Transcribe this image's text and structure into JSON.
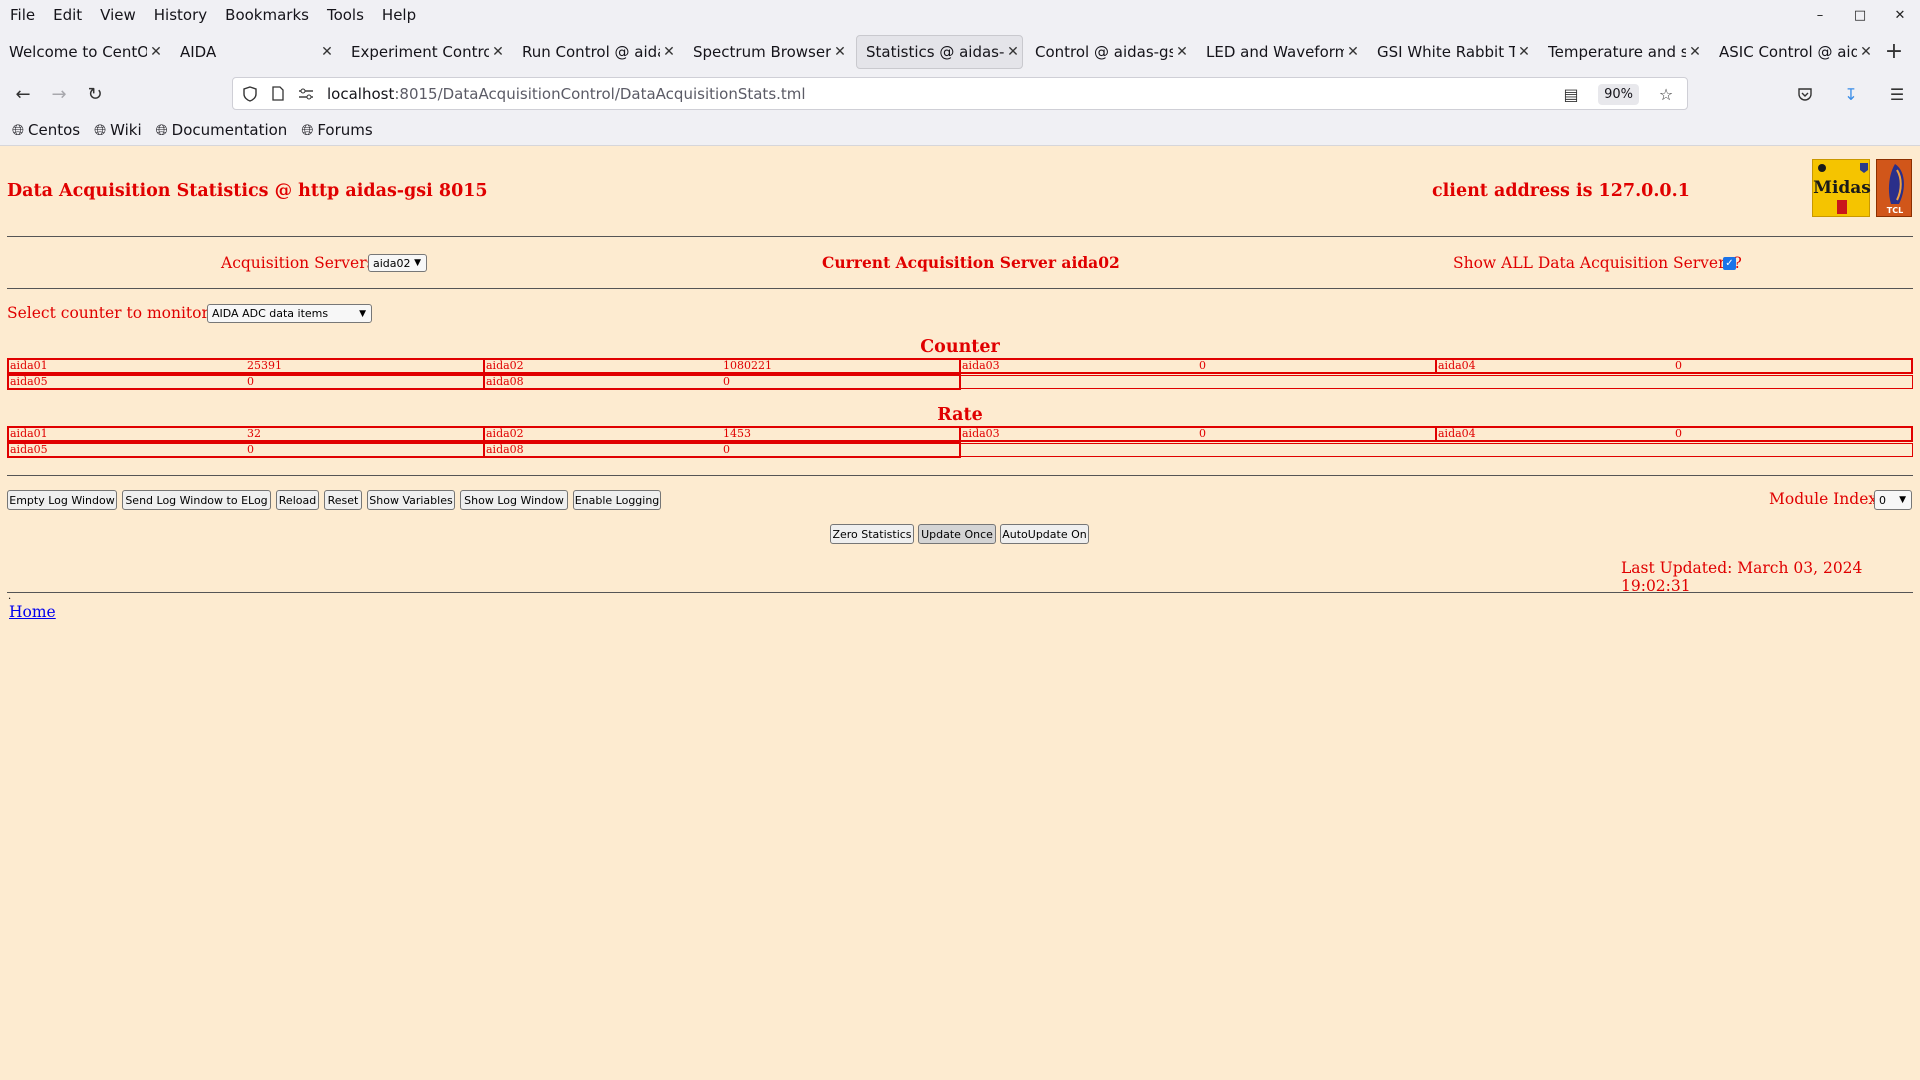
{
  "menu": [
    "File",
    "Edit",
    "View",
    "History",
    "Bookmarks",
    "Tools",
    "Help"
  ],
  "tabs": [
    {
      "label": "Welcome to CentOS",
      "active": false
    },
    {
      "label": "AIDA",
      "active": false
    },
    {
      "label": "Experiment Control @",
      "active": false
    },
    {
      "label": "Run Control @ aidas",
      "active": false
    },
    {
      "label": "Spectrum Browser @",
      "active": false
    },
    {
      "label": "Statistics @ aidas-gsi",
      "active": true
    },
    {
      "label": "Control @ aidas-gsi",
      "active": false
    },
    {
      "label": "LED and Waveform c",
      "active": false
    },
    {
      "label": "GSI White Rabbit Tin",
      "active": false
    },
    {
      "label": "Temperature and sta",
      "active": false
    },
    {
      "label": "ASIC Control @ aida",
      "active": false
    }
  ],
  "url": {
    "host": "localhost",
    "rest": ":8015/DataAcquisitionControl/DataAcquisitionStats.tml"
  },
  "zoom": "90%",
  "bookmarks": [
    "Centos",
    "Wiki",
    "Documentation",
    "Forums"
  ],
  "page": {
    "title": "Data Acquisition Statistics @ http aidas-gsi 8015",
    "client": "client address is 127.0.0.1",
    "logo_midas": "Midas",
    "logo_tcl": "TCL",
    "acq_servers_label": "Acquisition Servers",
    "acq_server_value": "aida02",
    "current_server": "Current Acquisition Server aida02",
    "show_all_label": "Show ALL Data Acquisition Servers?",
    "select_counter_label": "Select counter to monitor",
    "counter_select_value": "AIDA ADC data items",
    "counter_title": "Counter",
    "counter_rows": [
      [
        {
          "name": "aida01",
          "value": "25391"
        },
        {
          "name": "aida02",
          "value": "1080221"
        },
        {
          "name": "aida03",
          "value": "0"
        },
        {
          "name": "aida04",
          "value": "0"
        }
      ],
      [
        {
          "name": "aida05",
          "value": "0"
        },
        {
          "name": "aida08",
          "value": "0"
        }
      ]
    ],
    "rate_title": "Rate",
    "rate_rows": [
      [
        {
          "name": "aida01",
          "value": "32"
        },
        {
          "name": "aida02",
          "value": "1453"
        },
        {
          "name": "aida03",
          "value": "0"
        },
        {
          "name": "aida04",
          "value": "0"
        }
      ],
      [
        {
          "name": "aida05",
          "value": "0"
        },
        {
          "name": "aida08",
          "value": "0"
        }
      ]
    ],
    "buttons_row1": [
      "Empty Log Window",
      "Send Log Window to ELog",
      "Reload",
      "Reset",
      "Show Variables",
      "Show Log Window",
      "Enable Logging"
    ],
    "module_index_label": "Module Index",
    "module_index_value": "0",
    "buttons_row2": [
      "Zero Statistics",
      "Update Once",
      "AutoUpdate On"
    ],
    "last_updated": "Last Updated: March 03, 2024 19:02:31",
    "dot": ".",
    "home_link": "Home"
  }
}
